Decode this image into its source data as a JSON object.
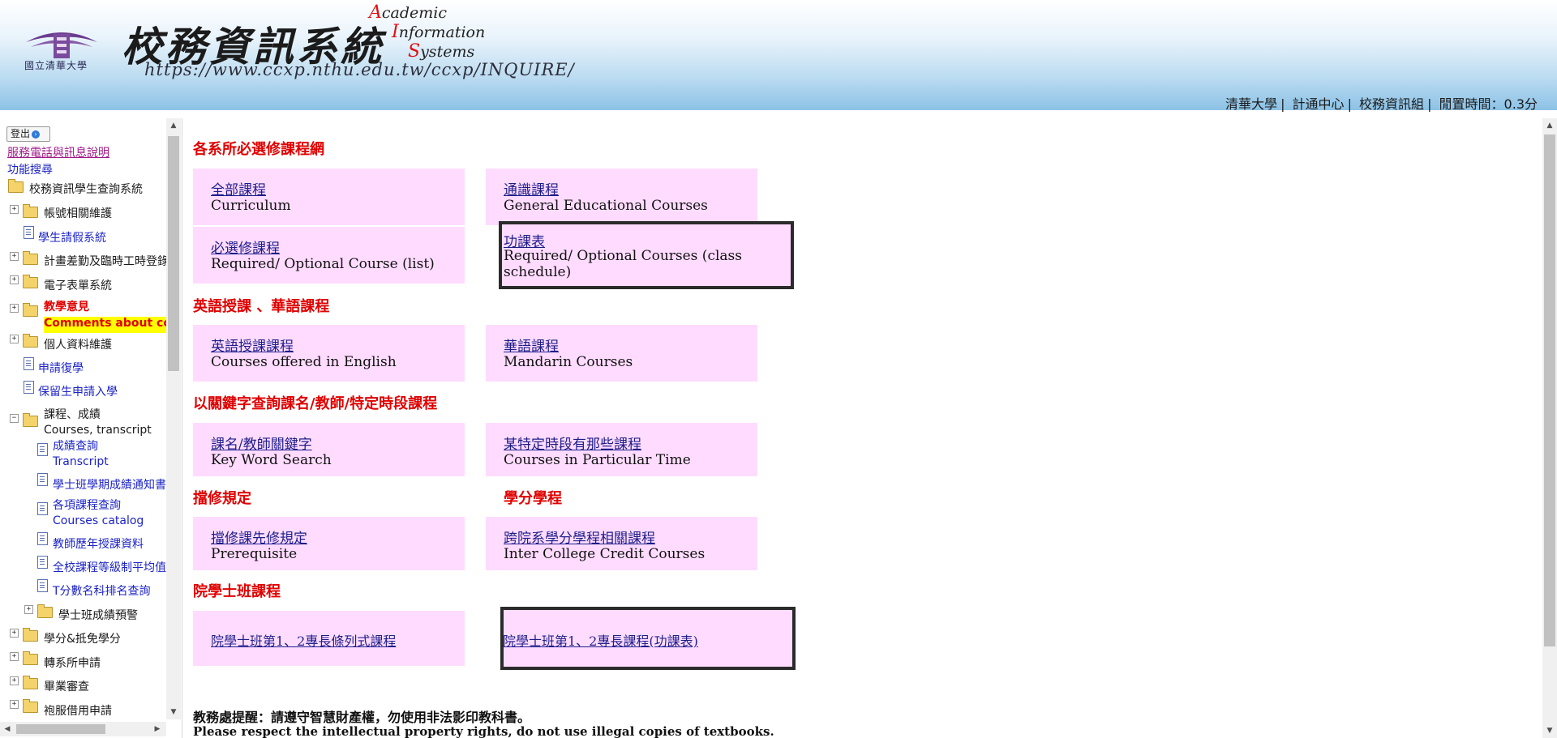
{
  "header": {
    "school_name": "國立清華大學",
    "title_cn": "校務資訊系統",
    "title_en_lines": [
      {
        "cap": "A",
        "rest": "cademic"
      },
      {
        "cap": "I",
        "rest": "nformation"
      },
      {
        "cap": "S",
        "rest": "ystems"
      }
    ],
    "url": "https://www.ccxp.nthu.edu.tw/ccxp/INQUIRE/",
    "links": [
      "清華大學",
      "計通中心",
      "校務資訊組"
    ],
    "separator": "|",
    "idle_label": "閒置時間：0.3分"
  },
  "sidebar": {
    "logout_label": "登出",
    "service_link": "服務電話與訊息說明",
    "search_link": "功能搜尋",
    "root_label": "校務資訊學生查詢系統",
    "items": [
      {
        "label": "帳號相關維護",
        "type": "folder"
      },
      {
        "label": "學生請假系統",
        "type": "doc"
      },
      {
        "label": "計畫差勤及臨時工時登錄",
        "type": "folder"
      },
      {
        "label": "電子表單系統",
        "type": "folder"
      },
      {
        "label": "教學意見",
        "sub": "Comments about courses",
        "type": "folder"
      },
      {
        "label": "個人資料維護",
        "type": "folder"
      },
      {
        "label": "申請復學",
        "type": "doc"
      },
      {
        "label": "保留生申請入學",
        "type": "doc"
      },
      {
        "label": "課程、成績",
        "sub": "Courses, transcript",
        "type": "folder-open"
      },
      {
        "label": "成績查詢",
        "sub": "Transcript",
        "type": "doc"
      },
      {
        "label": "學士班學期成績通知書",
        "type": "doc"
      },
      {
        "label": "各項課程查詢",
        "sub": "Courses catalog",
        "type": "doc"
      },
      {
        "label": "教師歷年授課資料",
        "type": "doc"
      },
      {
        "label": "全校課程等級制平均值",
        "type": "doc"
      },
      {
        "label": "T分數名科排名查詢",
        "type": "doc"
      },
      {
        "label": "學士班成績預警",
        "type": "folder"
      },
      {
        "label": "學分&抵免學分",
        "type": "folder"
      },
      {
        "label": "轉系所申請",
        "type": "folder"
      },
      {
        "label": "畢業審查",
        "type": "folder"
      },
      {
        "label": "袍服借用申請",
        "type": "folder"
      }
    ]
  },
  "main": {
    "sections": [
      {
        "title": "各系所必選修課程網"
      },
      {
        "title": "英語授課 、華語課程"
      },
      {
        "title": "以關鍵字查詢課名/教師/特定時段課程"
      },
      {
        "title": "擋修規定"
      },
      {
        "title": "學分學程"
      },
      {
        "title": "院學士班課程"
      }
    ],
    "cards": [
      {
        "zh": "全部課程",
        "en": "Curriculum"
      },
      {
        "zh": "通識課程",
        "en": "General Educational Courses"
      },
      {
        "zh": "必選修課程",
        "en": "Required/ Optional Course (list)"
      },
      {
        "zh": "功課表",
        "en": "Required/ Optional Courses (class schedule)"
      },
      {
        "zh": "英語授課課程",
        "en": "Courses offered in English"
      },
      {
        "zh": "華語課程",
        "en": "Mandarin Courses"
      },
      {
        "zh": "課名/教師關鍵字",
        "en": "Key Word Search"
      },
      {
        "zh": "某特定時段有那些課程",
        "en": "Courses in Particular Time"
      },
      {
        "zh": "擋修課先修規定",
        "en": "Prerequisite"
      },
      {
        "zh": "跨院系學分學程相關課程",
        "en": "Inter College Credit Courses"
      },
      {
        "zh": "院學士班第1、2專長條列式課程",
        "en": ""
      },
      {
        "zh": "院學士班第1、2專長課程(功課表)",
        "en": ""
      }
    ],
    "notice_zh": "教務處提醒：請遵守智慧財產權，勿使用非法影印教科書。",
    "notice_en": "Please respect the intellectual property rights, do not use illegal copies of textbooks."
  }
}
